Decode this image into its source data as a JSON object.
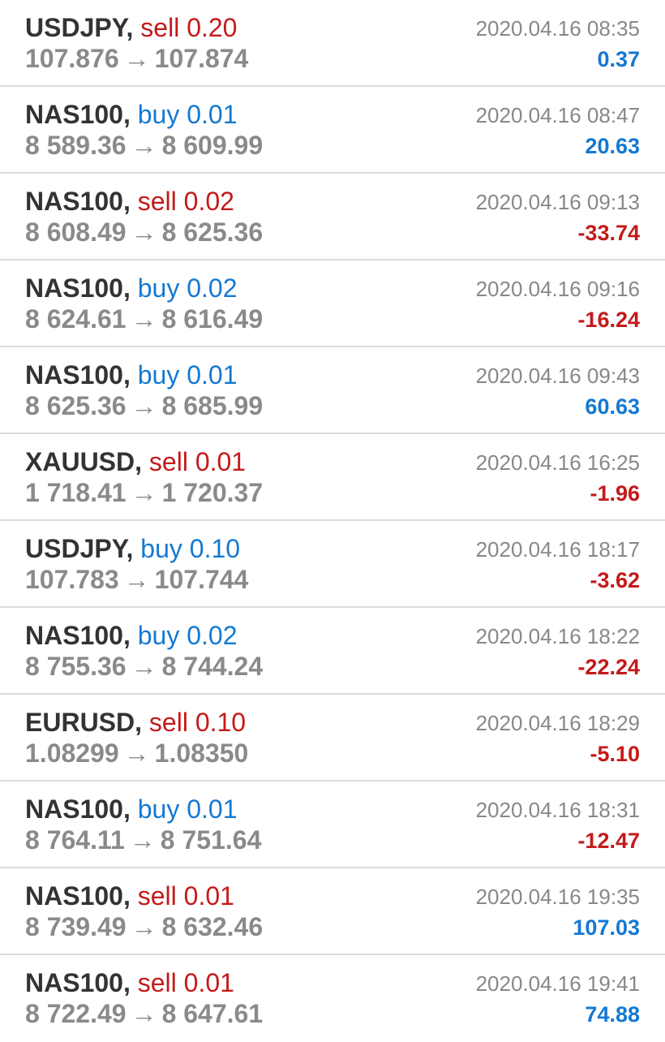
{
  "colors": {
    "sell": "#c41a1a",
    "buy": "#1479d2",
    "profit_positive": "#1479d2",
    "profit_negative": "#c41a1a",
    "price_text": "#8a8a8a",
    "symbol_text": "#333333",
    "time_text": "#888888",
    "divider": "#dcdcdc"
  },
  "arrow_glyph": "→",
  "trades": [
    {
      "symbol": "USDJPY",
      "side": "sell",
      "volume": "0.20",
      "open_price": "107.876",
      "close_price": "107.874",
      "time": "2020.04.16 08:35",
      "profit": "0.37"
    },
    {
      "symbol": "NAS100",
      "side": "buy",
      "volume": "0.01",
      "open_price": "8 589.36",
      "close_price": "8 609.99",
      "time": "2020.04.16 08:47",
      "profit": "20.63"
    },
    {
      "symbol": "NAS100",
      "side": "sell",
      "volume": "0.02",
      "open_price": "8 608.49",
      "close_price": "8 625.36",
      "time": "2020.04.16 09:13",
      "profit": "-33.74"
    },
    {
      "symbol": "NAS100",
      "side": "buy",
      "volume": "0.02",
      "open_price": "8 624.61",
      "close_price": "8 616.49",
      "time": "2020.04.16 09:16",
      "profit": "-16.24"
    },
    {
      "symbol": "NAS100",
      "side": "buy",
      "volume": "0.01",
      "open_price": "8 625.36",
      "close_price": "8 685.99",
      "time": "2020.04.16 09:43",
      "profit": "60.63"
    },
    {
      "symbol": "XAUUSD",
      "side": "sell",
      "volume": "0.01",
      "open_price": "1 718.41",
      "close_price": "1 720.37",
      "time": "2020.04.16 16:25",
      "profit": "-1.96"
    },
    {
      "symbol": "USDJPY",
      "side": "buy",
      "volume": "0.10",
      "open_price": "107.783",
      "close_price": "107.744",
      "time": "2020.04.16 18:17",
      "profit": "-3.62"
    },
    {
      "symbol": "NAS100",
      "side": "buy",
      "volume": "0.02",
      "open_price": "8 755.36",
      "close_price": "8 744.24",
      "time": "2020.04.16 18:22",
      "profit": "-22.24"
    },
    {
      "symbol": "EURUSD",
      "side": "sell",
      "volume": "0.10",
      "open_price": "1.08299",
      "close_price": "1.08350",
      "time": "2020.04.16 18:29",
      "profit": "-5.10"
    },
    {
      "symbol": "NAS100",
      "side": "buy",
      "volume": "0.01",
      "open_price": "8 764.11",
      "close_price": "8 751.64",
      "time": "2020.04.16 18:31",
      "profit": "-12.47"
    },
    {
      "symbol": "NAS100",
      "side": "sell",
      "volume": "0.01",
      "open_price": "8 739.49",
      "close_price": "8 632.46",
      "time": "2020.04.16 19:35",
      "profit": "107.03"
    },
    {
      "symbol": "NAS100",
      "side": "sell",
      "volume": "0.01",
      "open_price": "8 722.49",
      "close_price": "8 647.61",
      "time": "2020.04.16 19:41",
      "profit": "74.88"
    }
  ]
}
